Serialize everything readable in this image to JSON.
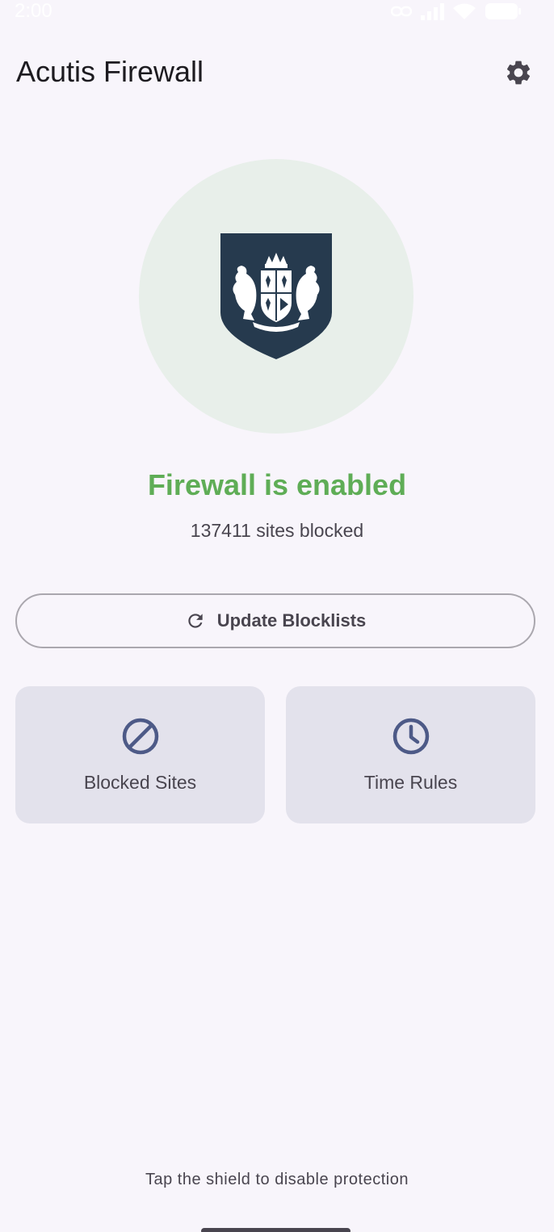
{
  "status_bar": {
    "time": "2:00",
    "icons": [
      "link-icon",
      "signal-icon",
      "wifi-icon",
      "battery-icon"
    ]
  },
  "app_bar": {
    "title": "Acutis Firewall",
    "settings_icon": "gear-icon"
  },
  "shield": {
    "state": "enabled",
    "circle_color": "#e8efea",
    "shield_color": "#263a4e"
  },
  "status": {
    "headline": "Firewall is enabled",
    "headline_color": "#5fad56",
    "count_text": "137411 sites blocked"
  },
  "update_button": {
    "label": "Update Blocklists",
    "icon": "refresh-icon"
  },
  "tiles": [
    {
      "label": "Blocked Sites",
      "icon": "blocked-icon"
    },
    {
      "label": "Time Rules",
      "icon": "clock-icon"
    }
  ],
  "footer": {
    "hint": "Tap the shield to disable protection"
  },
  "colors": {
    "background": "#f8f5fb",
    "tile": "#e3e2ec",
    "icon_accent": "#4d5a87"
  }
}
